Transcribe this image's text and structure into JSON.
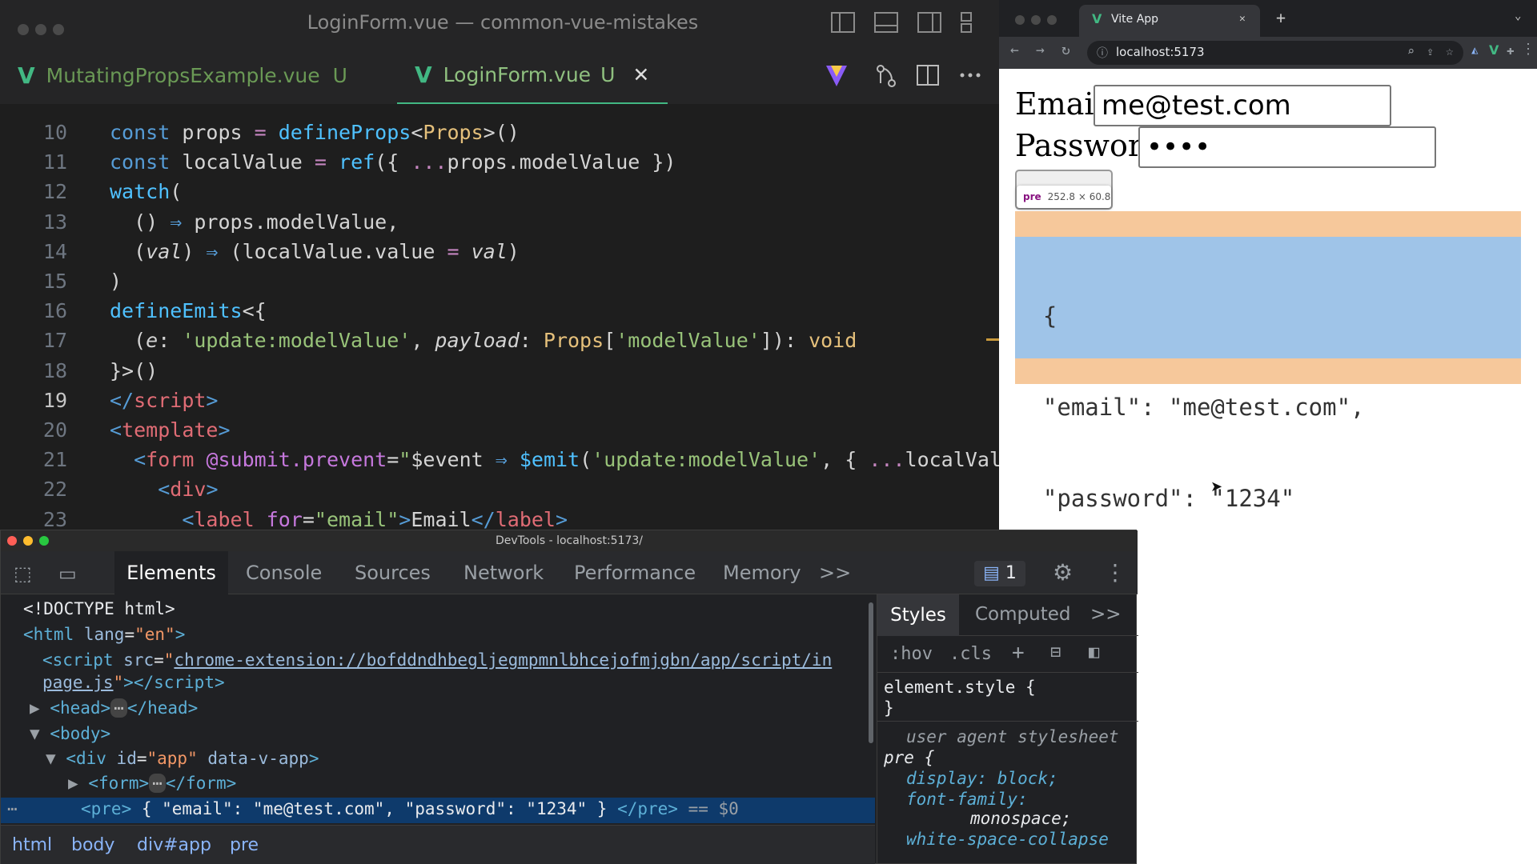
{
  "editor": {
    "window_title": "LoginForm.vue — common-vue-mistakes",
    "tabs": [
      {
        "name": "MutatingPropsExample.vue",
        "badge": "U"
      },
      {
        "name": "LoginForm.vue",
        "badge": "U",
        "close": "✕"
      }
    ],
    "line_numbers": [
      "10",
      "11",
      "12",
      "13",
      "14",
      "15",
      "16",
      "17",
      "18",
      "19",
      "20",
      "21",
      "22",
      "23"
    ]
  },
  "browser": {
    "tab_title": "Vite App",
    "tab_close": "✕",
    "new_tab": "+",
    "url": "localhost:5173",
    "form": {
      "email_label": "Email",
      "email_value": "me@test.com",
      "password_label": "Password",
      "password_value": "••••"
    },
    "tooltip": {
      "tag": "pre",
      "size": "252.8 × 60.8"
    },
    "pre_lines": [
      "  {",
      "  \"email\": \"me@test.com\",",
      "  \"password\": \"1234\"",
      "}"
    ]
  },
  "devtools": {
    "title": "DevTools - localhost:5173/",
    "tabs": [
      "Elements",
      "Console",
      "Sources",
      "Network",
      "Performance",
      "Memory"
    ],
    "more": ">>",
    "issues_count": "1",
    "breadcrumbs": [
      "html",
      "body",
      "div#app",
      "pre"
    ],
    "styles_tabs": [
      "Styles",
      "Computed"
    ],
    "styles_tools": [
      ":hov",
      ".cls"
    ],
    "styles_lines": [
      "element.style {",
      "}",
      "user agent stylesheet",
      "pre {",
      "display: block;",
      "font-family:",
      "monospace;",
      "white-space-collapse"
    ]
  },
  "colors": {
    "vue_green": "#42b883",
    "tab_active": "#42b883",
    "pre_margin": "#f6c89b",
    "pre_content": "#9fc4e8"
  }
}
